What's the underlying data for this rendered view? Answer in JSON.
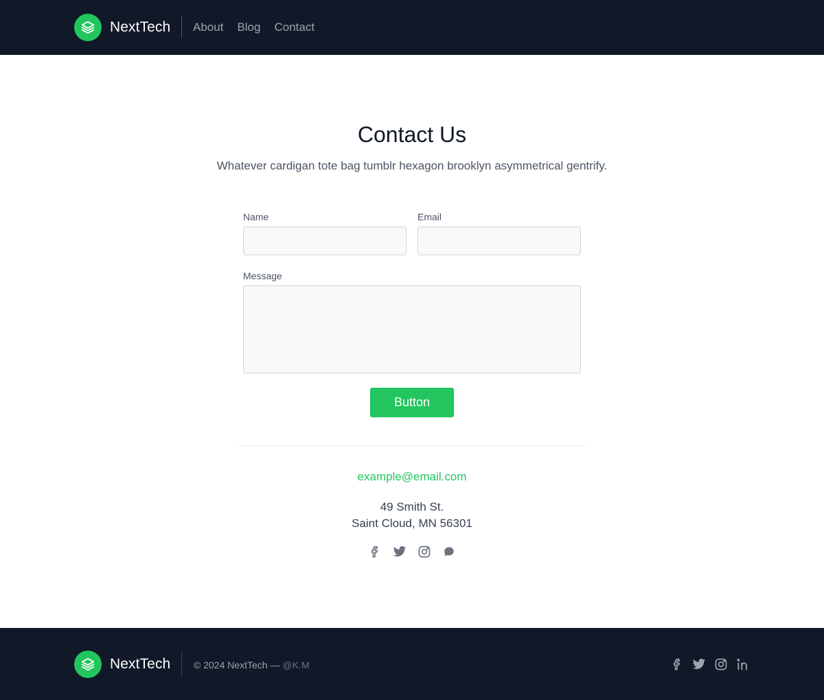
{
  "brand": {
    "name": "NextTech"
  },
  "nav": {
    "about": "About",
    "blog": "Blog",
    "contact": "Contact"
  },
  "page": {
    "title": "Contact Us",
    "subtitle": "Whatever cardigan tote bag tumblr hexagon brooklyn asymmetrical gentrify."
  },
  "form": {
    "name_label": "Name",
    "name_value": "",
    "email_label": "Email",
    "email_value": "",
    "message_label": "Message",
    "message_value": "",
    "submit_label": "Button"
  },
  "contact": {
    "email": "example@email.com",
    "address_line1": "49 Smith St.",
    "address_line2": "Saint Cloud, MN 56301",
    "social_icons": [
      "facebook-icon",
      "twitter-icon",
      "instagram-icon",
      "chat-icon"
    ]
  },
  "footer": {
    "brand_name": "NextTech",
    "copyright": "© 2024 NextTech — ",
    "handle": "@K.M",
    "social_icons": [
      "facebook-icon",
      "twitter-icon",
      "instagram-icon",
      "linkedin-icon"
    ]
  },
  "colors": {
    "accent": "#22c55e",
    "dark": "#111827",
    "muted": "#9ca3af"
  }
}
